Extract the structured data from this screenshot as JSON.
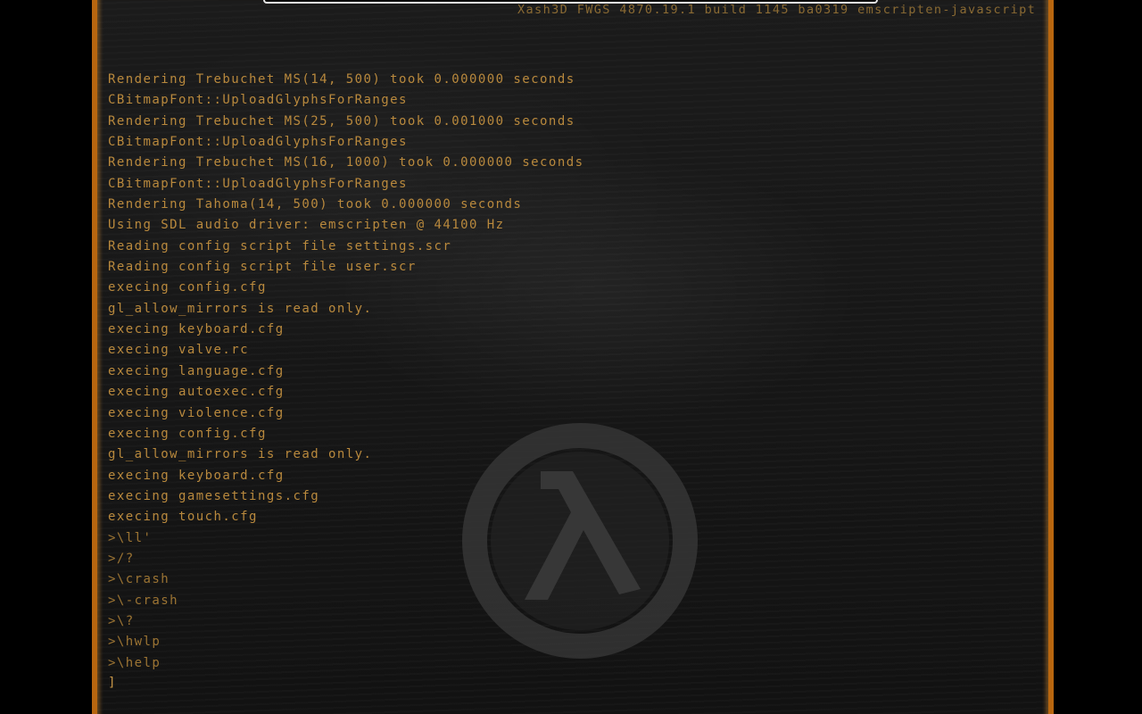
{
  "console": {
    "version": "Xash3D FWGS 4870.19.1 build 1145 ba0319 emscripten-javascript",
    "lines": [
      "Rendering Trebuchet MS(14, 500) took 0.000000 seconds",
      "CBitmapFont::UploadGlyphsForRanges",
      "Rendering Trebuchet MS(25, 500) took 0.001000 seconds",
      "CBitmapFont::UploadGlyphsForRanges",
      "Rendering Trebuchet MS(16, 1000) took 0.000000 seconds",
      "CBitmapFont::UploadGlyphsForRanges",
      "Rendering Tahoma(14, 500) took 0.000000 seconds",
      "Using SDL audio driver: emscripten @ 44100 Hz",
      "Reading config script file settings.scr",
      "Reading config script file user.scr",
      "execing config.cfg",
      "gl_allow_mirrors is read only.",
      "execing keyboard.cfg",
      "execing valve.rc",
      "execing language.cfg",
      "execing autoexec.cfg",
      "execing violence.cfg",
      "execing config.cfg",
      "gl_allow_mirrors is read only.",
      "execing keyboard.cfg",
      "execing gamesettings.cfg",
      "execing touch.cfg",
      ">\\ll'",
      ">/?",
      ">\\crash",
      ">\\-crash",
      ">\\?",
      ">\\hwlp",
      ">\\help"
    ],
    "prompt": "]",
    "input_value": ""
  },
  "icons": {
    "background_logo": "half-life-lambda-logo"
  },
  "colors": {
    "text": "#b9893d",
    "border": "#b8660f",
    "background": "#171717"
  }
}
